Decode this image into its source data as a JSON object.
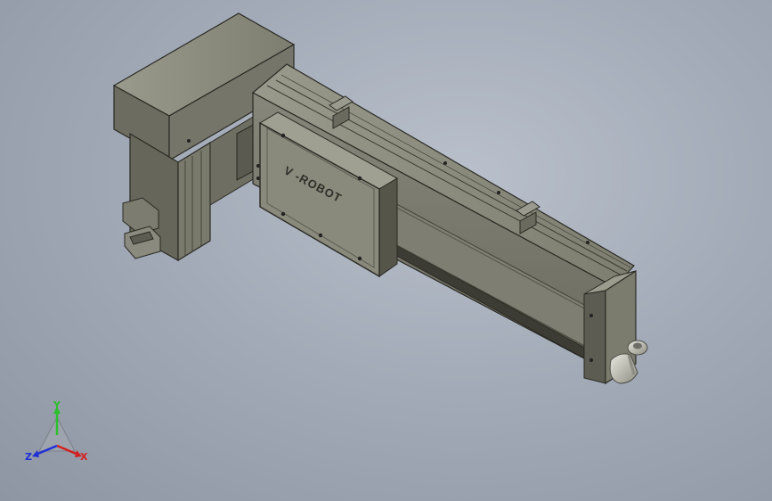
{
  "viewport": {
    "background_top": "#b9c0cb",
    "background_bottom": "#8e96a4"
  },
  "model": {
    "logo_mark": "V",
    "logo_text": "-ROBOT",
    "body_color": "#7d7d6e",
    "motor_color": "#6f6f62"
  },
  "triad": {
    "y_label": "Y",
    "x_label": "X",
    "z_label": "Z",
    "y_color": "#2bbf2b",
    "x_color": "#d42020",
    "z_color": "#2030d4"
  }
}
